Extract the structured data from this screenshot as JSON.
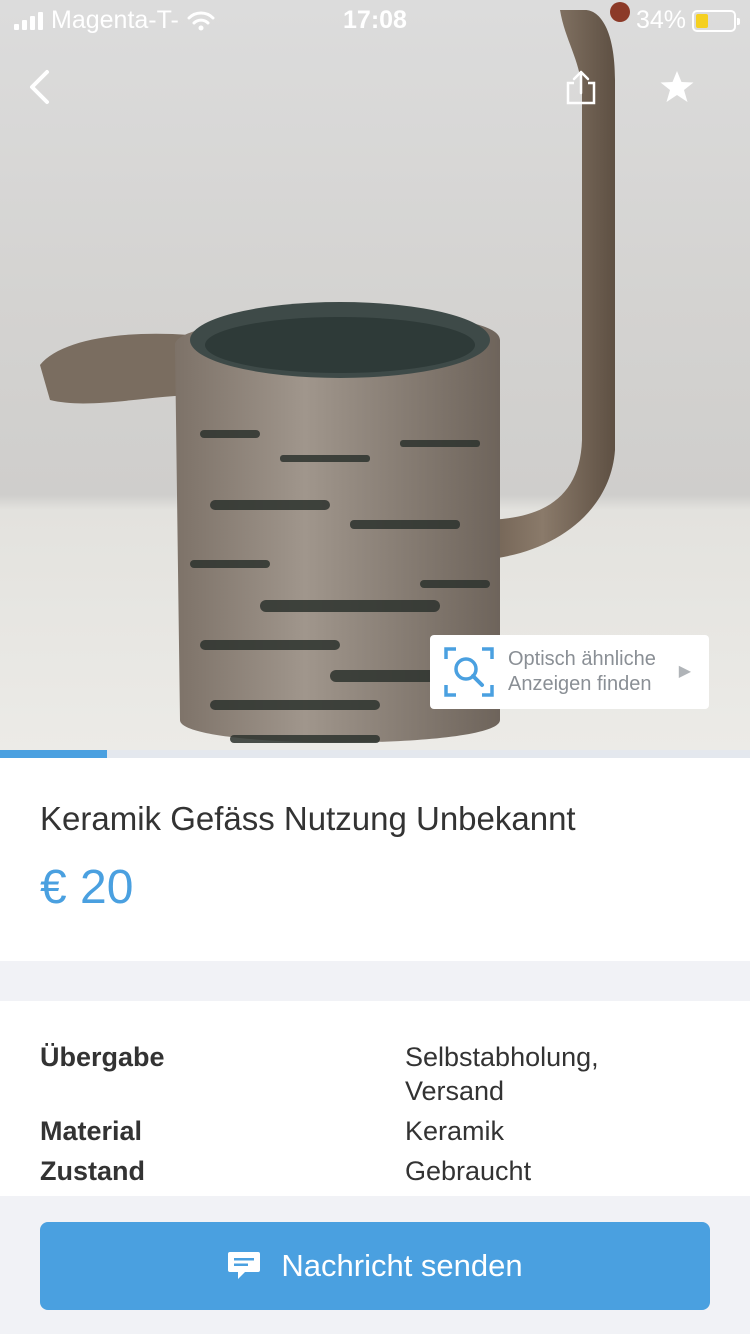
{
  "status_bar": {
    "carrier": "Magenta-T-",
    "time": "17:08",
    "battery": "34%"
  },
  "nav": {
    "back_icon": "chevron-left-icon",
    "share_icon": "share-icon",
    "favorite_icon": "star-icon"
  },
  "similar_search": {
    "line1": "Optisch ähnliche",
    "line2": "Anzeigen finden",
    "icon": "visual-search-icon"
  },
  "carousel": {
    "progress_fraction": 0.143
  },
  "listing": {
    "title": "Keramik Gefäss Nutzung Unbekannt",
    "price": "€ 20"
  },
  "details": [
    {
      "key": "Übergabe",
      "value": "Selbstabholung, Versand"
    },
    {
      "key": "Material",
      "value": "Keramik"
    },
    {
      "key": "Zustand",
      "value": "Gebraucht"
    }
  ],
  "cta": {
    "label": "Nachricht senden",
    "icon": "chat-bubble-icon"
  },
  "colors": {
    "accent": "#4aa0e0",
    "battery_low": "#f5d020",
    "band": "#f1f2f6"
  }
}
